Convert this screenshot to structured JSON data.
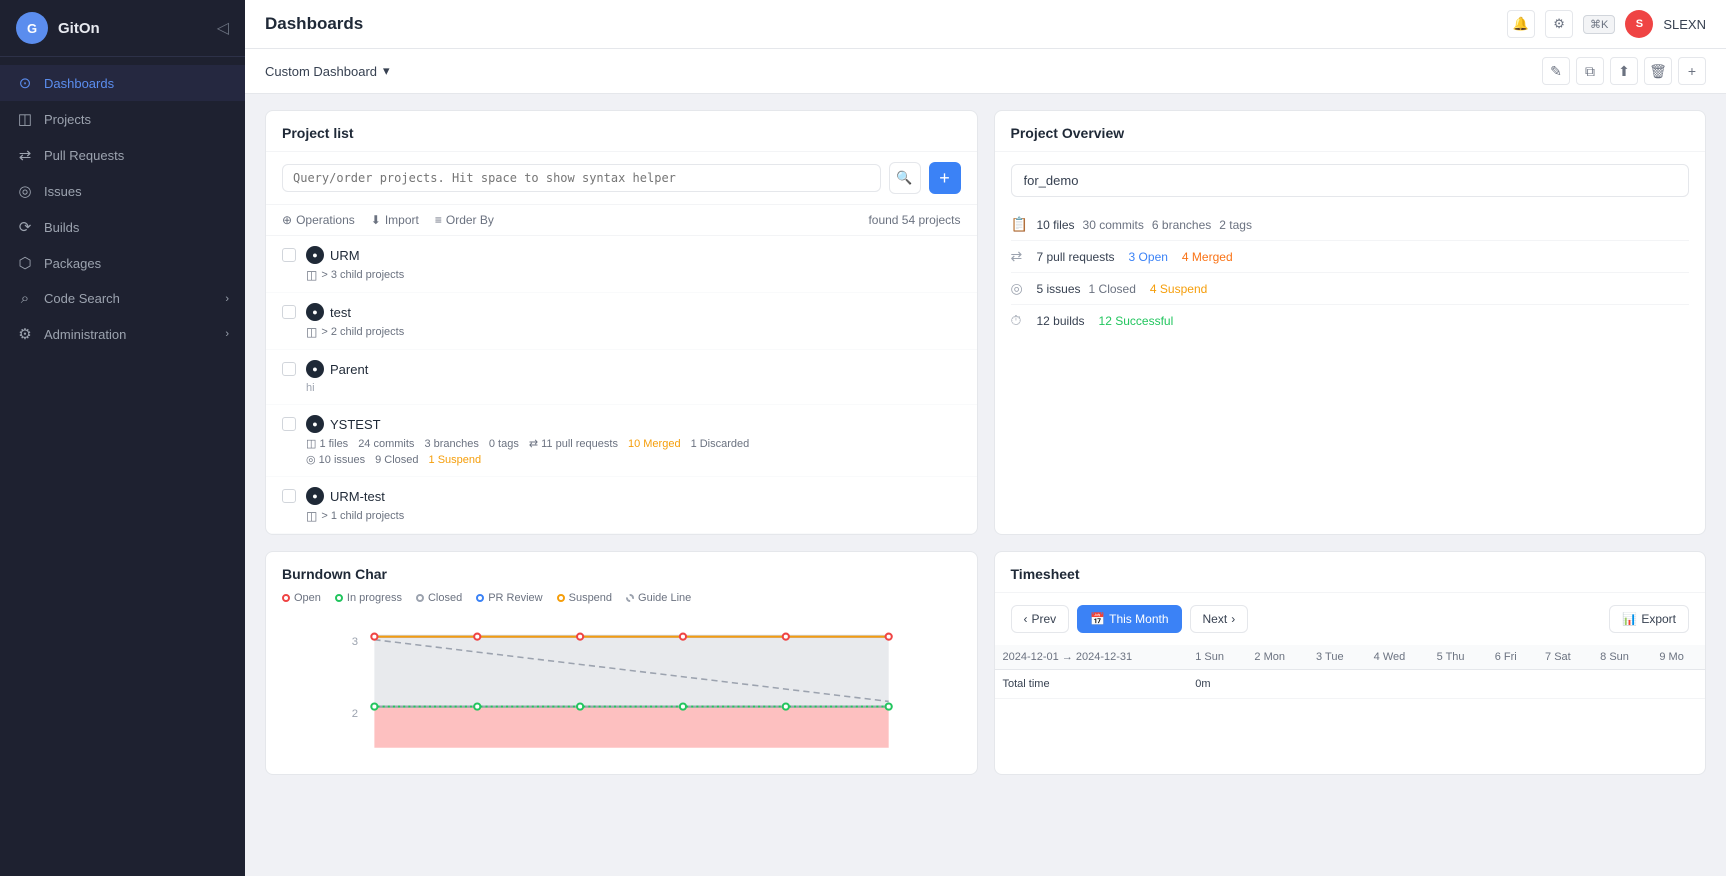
{
  "app": {
    "name": "GitOn",
    "title": "Dashboards"
  },
  "sidebar": {
    "items": [
      {
        "id": "dashboards",
        "label": "Dashboards",
        "icon": "⊙",
        "active": true
      },
      {
        "id": "projects",
        "label": "Projects",
        "icon": "◫"
      },
      {
        "id": "pull-requests",
        "label": "Pull Requests",
        "icon": "⇄"
      },
      {
        "id": "issues",
        "label": "Issues",
        "icon": "◎"
      },
      {
        "id": "builds",
        "label": "Builds",
        "icon": "⟳"
      },
      {
        "id": "packages",
        "label": "Packages",
        "icon": "⬡"
      },
      {
        "id": "code-search",
        "label": "Code Search",
        "icon": "⌕",
        "hasChevron": true
      },
      {
        "id": "administration",
        "label": "Administration",
        "icon": "⚙",
        "hasChevron": true
      }
    ]
  },
  "topbar": {
    "title": "Dashboards",
    "notification_icon": "🔔",
    "settings_icon": "⚙",
    "kbd_hint": "⌘K",
    "user_initial": "S",
    "user_name": "SLEXN"
  },
  "sub_topbar": {
    "dashboard_name": "Custom Dashboard",
    "chevron": "▾",
    "actions": [
      "edit",
      "copy",
      "share",
      "delete",
      "add"
    ]
  },
  "project_list": {
    "panel_title": "Project list",
    "search_placeholder": "Query/order projects. Hit space to show syntax helper",
    "found_count": "found 54 projects",
    "toolbar": {
      "operations": "Operations",
      "import": "Import",
      "order_by": "Order By"
    },
    "projects": [
      {
        "name": "URM",
        "meta": "3 child projects",
        "detail": ""
      },
      {
        "name": "test",
        "meta": "2 child projects",
        "detail": ""
      },
      {
        "name": "Parent",
        "meta": "",
        "detail": "hi"
      },
      {
        "name": "YSTEST",
        "meta": "",
        "detail": "1 files   24 commits   3 branches   0 tags   11 pull requests   10 Merged   1 Discarded",
        "issues": "10 issues   9 Closed   1 Suspend"
      },
      {
        "name": "URM-test",
        "meta": "1 child projects",
        "detail": ""
      }
    ]
  },
  "project_overview": {
    "panel_title": "Project Overview",
    "search_value": "for_demo",
    "stats": [
      {
        "icon": "📋",
        "label": "10 files",
        "values": "30 commits   6 branches   2 tags"
      },
      {
        "icon": "⇄",
        "label": "7 pull requests",
        "open": "3 Open",
        "merged": "4 Merged"
      },
      {
        "icon": "◎",
        "label": "5 issues",
        "closed": "1 Closed",
        "suspend": "4 Suspend"
      },
      {
        "icon": "⏱",
        "label": "12 builds",
        "successful": "12 Successful"
      }
    ]
  },
  "burndown": {
    "panel_title": "Burndown Char",
    "legend": [
      {
        "id": "open",
        "label": "Open",
        "color": "#ef4444"
      },
      {
        "id": "inprogress",
        "label": "In progress",
        "color": "#22c55e"
      },
      {
        "id": "closed",
        "label": "Closed",
        "color": "#9ca3af"
      },
      {
        "id": "prreview",
        "label": "PR Review",
        "color": "#3b82f6"
      },
      {
        "id": "suspend",
        "label": "Suspend",
        "color": "#f59e0b"
      },
      {
        "id": "guideline",
        "label": "Guide Line",
        "color": "#9ca3af",
        "dashed": true
      }
    ],
    "y_labels": [
      "3",
      "2"
    ],
    "chart_data": {
      "gray_fill": true,
      "red_fill": true
    }
  },
  "timesheet": {
    "panel_title": "Timesheet",
    "prev_label": "Prev",
    "this_month_label": "This Month",
    "next_label": "Next",
    "export_label": "Export",
    "date_range": "2024-12-01 → 2024-12-31",
    "columns": [
      "1 Sun",
      "2 Mon",
      "3 Tue",
      "4 Wed",
      "5 Thu",
      "6 Fri",
      "7 Sat",
      "8 Sun",
      "9 Mo"
    ],
    "total_label": "Total time",
    "total_value": "0m"
  }
}
